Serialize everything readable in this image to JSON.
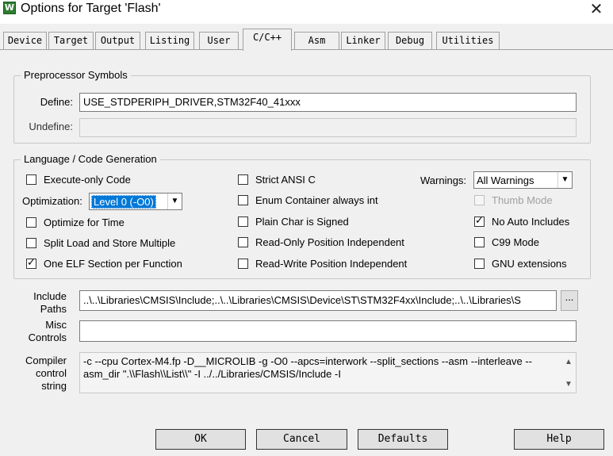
{
  "window": {
    "title": "Options for Target 'Flash'",
    "icon_glyph": "W",
    "close_glyph": "✕"
  },
  "tabs": [
    "Device",
    "Target",
    "Output",
    "Listing",
    "User",
    "C/C++",
    "Asm",
    "Linker",
    "Debug",
    "Utilities"
  ],
  "active_tab": "C/C++",
  "preprocessor": {
    "title": "Preprocessor Symbols",
    "define_label": "Define:",
    "define_value": "USE_STDPERIPH_DRIVER,STM32F40_41xxx",
    "undefine_label": "Undefine:",
    "undefine_value": ""
  },
  "language": {
    "title": "Language / Code Generation",
    "execute_only": {
      "label": "Execute-only Code",
      "checked": false
    },
    "optimization_label": "Optimization:",
    "optimization_value": "Level 0 (-O0)",
    "optimize_time": {
      "label": "Optimize for Time",
      "checked": false
    },
    "split_load": {
      "label": "Split Load and Store Multiple",
      "checked": false
    },
    "one_elf": {
      "label": "One ELF Section per Function",
      "checked": true
    },
    "strict_ansi": {
      "label": "Strict ANSI C",
      "checked": false
    },
    "enum_container": {
      "label": "Enum Container always int",
      "checked": false
    },
    "plain_char": {
      "label": "Plain Char is Signed",
      "checked": false
    },
    "ro_pi": {
      "label": "Read-Only Position Independent",
      "checked": false
    },
    "rw_pi": {
      "label": "Read-Write Position Independent",
      "checked": false
    },
    "warnings_label": "Warnings:",
    "warnings_value": "All Warnings",
    "thumb_mode": {
      "label": "Thumb Mode",
      "checked": false,
      "disabled": true
    },
    "no_auto_includes": {
      "label": "No Auto Includes",
      "checked": true
    },
    "c99_mode": {
      "label": "C99 Mode",
      "checked": false
    },
    "gnu_ext": {
      "label": "GNU extensions",
      "checked": false
    }
  },
  "include": {
    "label_line1": "Include",
    "label_line2": "Paths",
    "value": "..\\..\\Libraries\\CMSIS\\Include;..\\..\\Libraries\\CMSIS\\Device\\ST\\STM32F4xx\\Include;..\\..\\Libraries\\S",
    "browse_label": "..."
  },
  "misc": {
    "label_line1": "Misc",
    "label_line2": "Controls",
    "value": ""
  },
  "compiler": {
    "label_line1": "Compiler",
    "label_line2": "control",
    "label_line3": "string",
    "line1": "-c --cpu Cortex-M4.fp -D__MICROLIB -g -O0 --apcs=interwork --split_sections --asm --interleave --",
    "line2": "asm_dir \".\\\\Flash\\\\List\\\\\" -I ../../Libraries/CMSIS/Include -I"
  },
  "buttons": {
    "ok": "OK",
    "cancel": "Cancel",
    "defaults": "Defaults",
    "help": "Help"
  },
  "icons": {
    "dropdown": "▼",
    "scroll_up": "▲",
    "scroll_down": "▼"
  }
}
